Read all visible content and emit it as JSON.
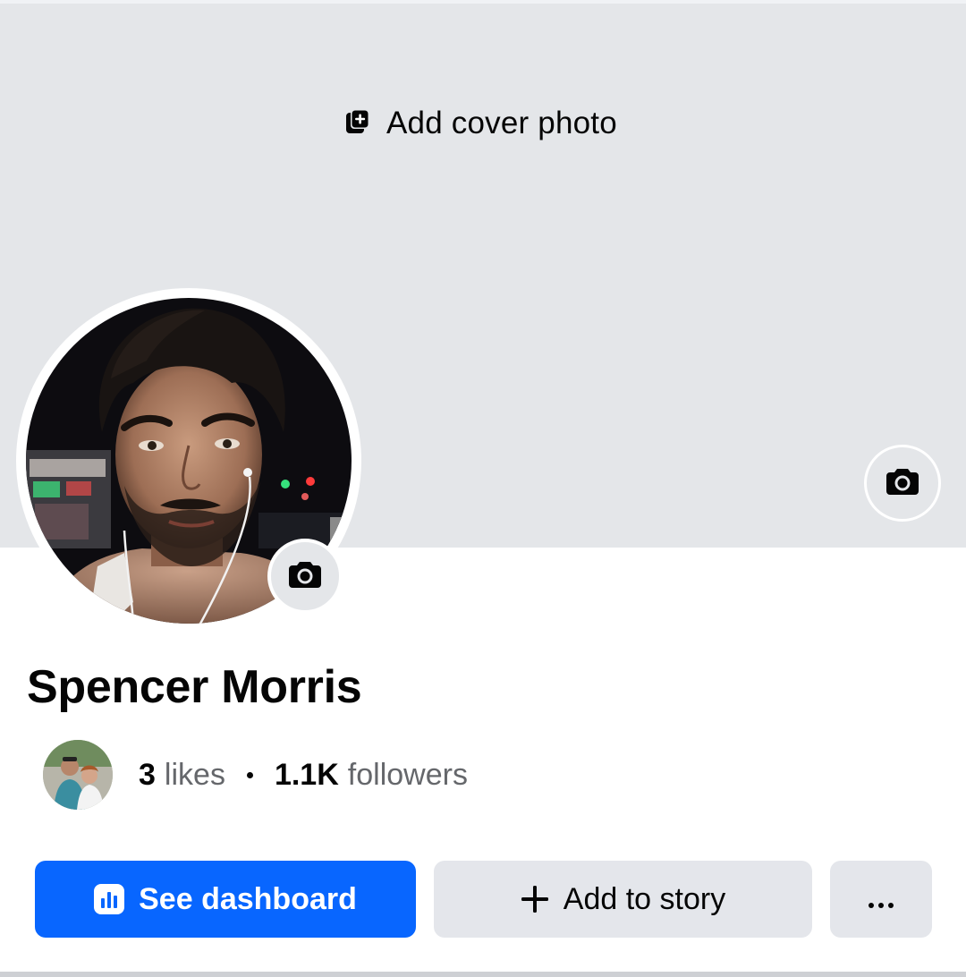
{
  "cover": {
    "add_cover_label": "Add cover photo",
    "camera_icon": "camera-icon",
    "background": "#e4e6e9"
  },
  "profile": {
    "name": "Spencer Morris",
    "avatar_camera_icon": "camera-icon"
  },
  "stats": {
    "likes_count": "3",
    "likes_label": "likes",
    "followers_count": "1.1K",
    "followers_label": "followers",
    "separator": "•"
  },
  "actions": {
    "dashboard_label": "See dashboard",
    "dashboard_icon": "bar-chart-icon",
    "story_label": "Add to story",
    "story_icon": "plus-icon",
    "more_label": "···"
  },
  "colors": {
    "primary": "#0866ff",
    "secondary_button": "#e4e6eb",
    "muted_text": "#65676b"
  }
}
